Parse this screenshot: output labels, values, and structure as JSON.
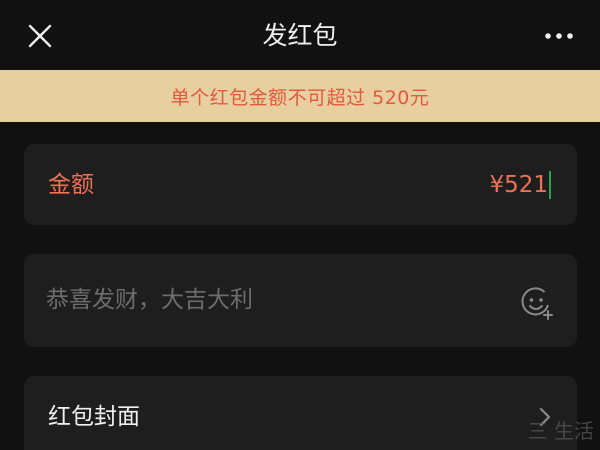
{
  "navbar": {
    "title": "发红包",
    "close_icon": "close-icon",
    "more_icon": "more-dots-icon"
  },
  "warning": {
    "text": "单个红包金额不可超过 520元"
  },
  "amount": {
    "label": "金额",
    "value": "¥521"
  },
  "greeting": {
    "placeholder": "恭喜发财，大吉大利",
    "emoji_icon": "emoji-add-icon"
  },
  "cover": {
    "label": "红包封面",
    "chevron_icon": "chevron-right-icon"
  },
  "watermark": {
    "text": "三  生活"
  },
  "colors": {
    "background": "#111111",
    "card": "#1e1e1e",
    "warning_bg": "#e8cf9f",
    "warning_text": "#e2593d",
    "amount_text": "#f07156",
    "cursor": "#2ba34a",
    "placeholder": "#6d6d6d"
  }
}
